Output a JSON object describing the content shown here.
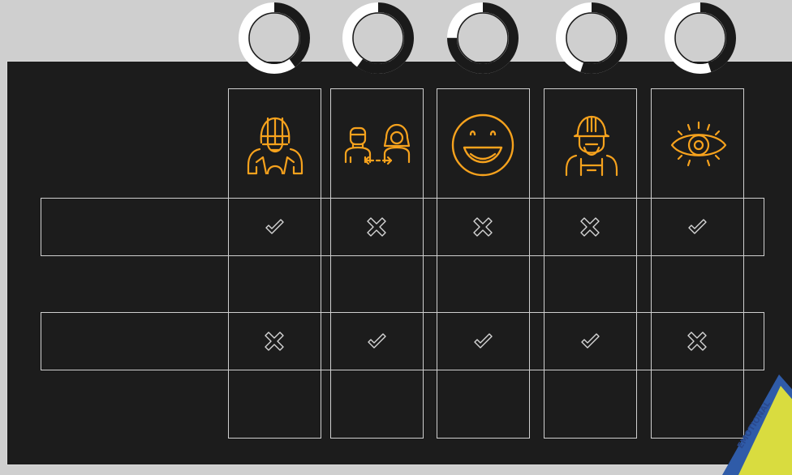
{
  "colors": {
    "accent": "#f6a21d",
    "line": "#cfcfcf",
    "board": "#1c1c1c",
    "badge_blue": "#2f5ba8",
    "badge_yellow": "#d9dc3f"
  },
  "donuts": [
    {
      "icon": "progress-ring",
      "value": 0.4
    },
    {
      "icon": "progress-ring",
      "value": 0.6
    },
    {
      "icon": "progress-ring",
      "value": 0.75
    },
    {
      "icon": "progress-ring",
      "value": 0.55
    },
    {
      "icon": "progress-ring",
      "value": 0.45
    }
  ],
  "columns": [
    {
      "icon": "football-player-icon"
    },
    {
      "icon": "people-exchange-icon"
    },
    {
      "icon": "smiley-face-icon"
    },
    {
      "icon": "construction-worker-icon"
    },
    {
      "icon": "eye-icon"
    }
  ],
  "rows": [
    {
      "marks": [
        "check",
        "cross",
        "cross",
        "cross",
        "check"
      ]
    },
    {
      "marks": [
        "cross",
        "check",
        "check",
        "check",
        "cross"
      ]
    }
  ],
  "badge": {
    "text": "EMOTIONAL"
  }
}
